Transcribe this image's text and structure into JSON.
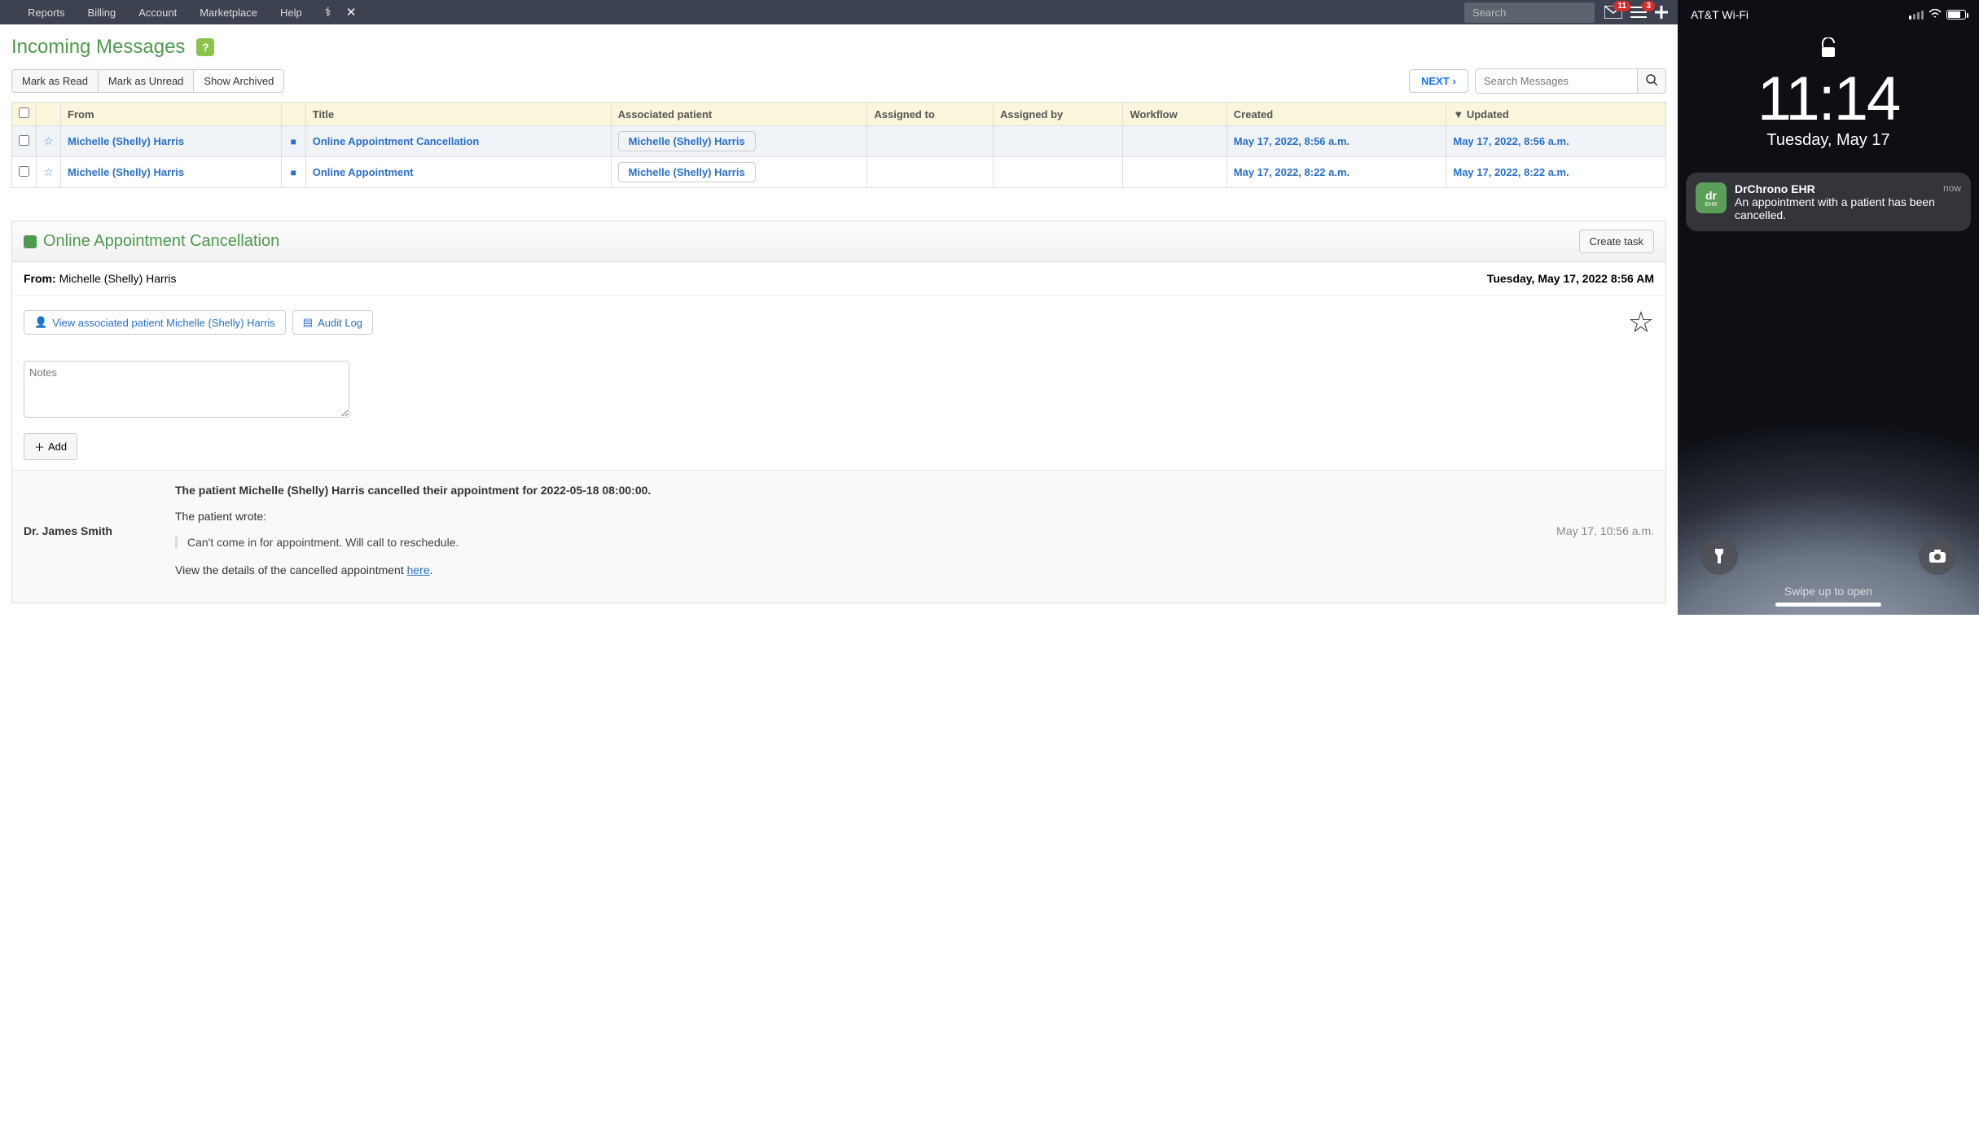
{
  "topnav": {
    "links": [
      "Reports",
      "Billing",
      "Account",
      "Marketplace",
      "Help"
    ],
    "search_placeholder": "Search",
    "mail_badge": "11",
    "list_badge": "3"
  },
  "page": {
    "title": "Incoming Messages"
  },
  "toolbar": {
    "mark_read": "Mark as Read",
    "mark_unread": "Mark as Unread",
    "show_archived": "Show Archived",
    "next": "NEXT",
    "search_placeholder": "Search Messages"
  },
  "table": {
    "headers": {
      "from": "From",
      "title": "Title",
      "patient": "Associated patient",
      "assigned_to": "Assigned to",
      "assigned_by": "Assigned by",
      "workflow": "Workflow",
      "created": "Created",
      "updated": "▼ Updated"
    },
    "rows": [
      {
        "from": "Michelle (Shelly) Harris",
        "title": "Online Appointment Cancellation",
        "patient": "Michelle (Shelly) Harris",
        "created": "May 17, 2022, 8:56 a.m.",
        "updated": "May 17, 2022, 8:56 a.m."
      },
      {
        "from": "Michelle (Shelly) Harris",
        "title": "Online Appointment",
        "patient": "Michelle (Shelly) Harris",
        "created": "May 17, 2022, 8:22 a.m.",
        "updated": "May 17, 2022, 8:22 a.m."
      }
    ]
  },
  "detail": {
    "title": "Online Appointment Cancellation",
    "create_task": "Create task",
    "from_label": "From:",
    "from_value": "Michelle (Shelly) Harris",
    "timestamp": "Tuesday, May 17, 2022 8:56 AM",
    "view_patient": "View associated patient Michelle (Shelly) Harris",
    "audit_log": "Audit Log",
    "notes_placeholder": "Notes",
    "add": "Add",
    "body": {
      "author": "Dr. James Smith",
      "time": "May 17, 10:56 a.m.",
      "line1": "The patient Michelle (Shelly) Harris cancelled their appointment for 2022-05-18 08:00:00.",
      "line2": "The patient wrote:",
      "quote": "Can't come in for appointment. Will call to reschedule.",
      "line3_a": "View the details of the cancelled appointment ",
      "line3_link": "here",
      "line3_b": "."
    }
  },
  "phone": {
    "carrier": "AT&T Wi-Fi",
    "time": "11:14",
    "date": "Tuesday, May 17",
    "notif": {
      "icon_text": "dr",
      "icon_sub": "EHR",
      "app": "DrChrono EHR",
      "when": "now",
      "body": "An appointment with a patient has been cancelled."
    },
    "swipe": "Swipe up to open"
  }
}
